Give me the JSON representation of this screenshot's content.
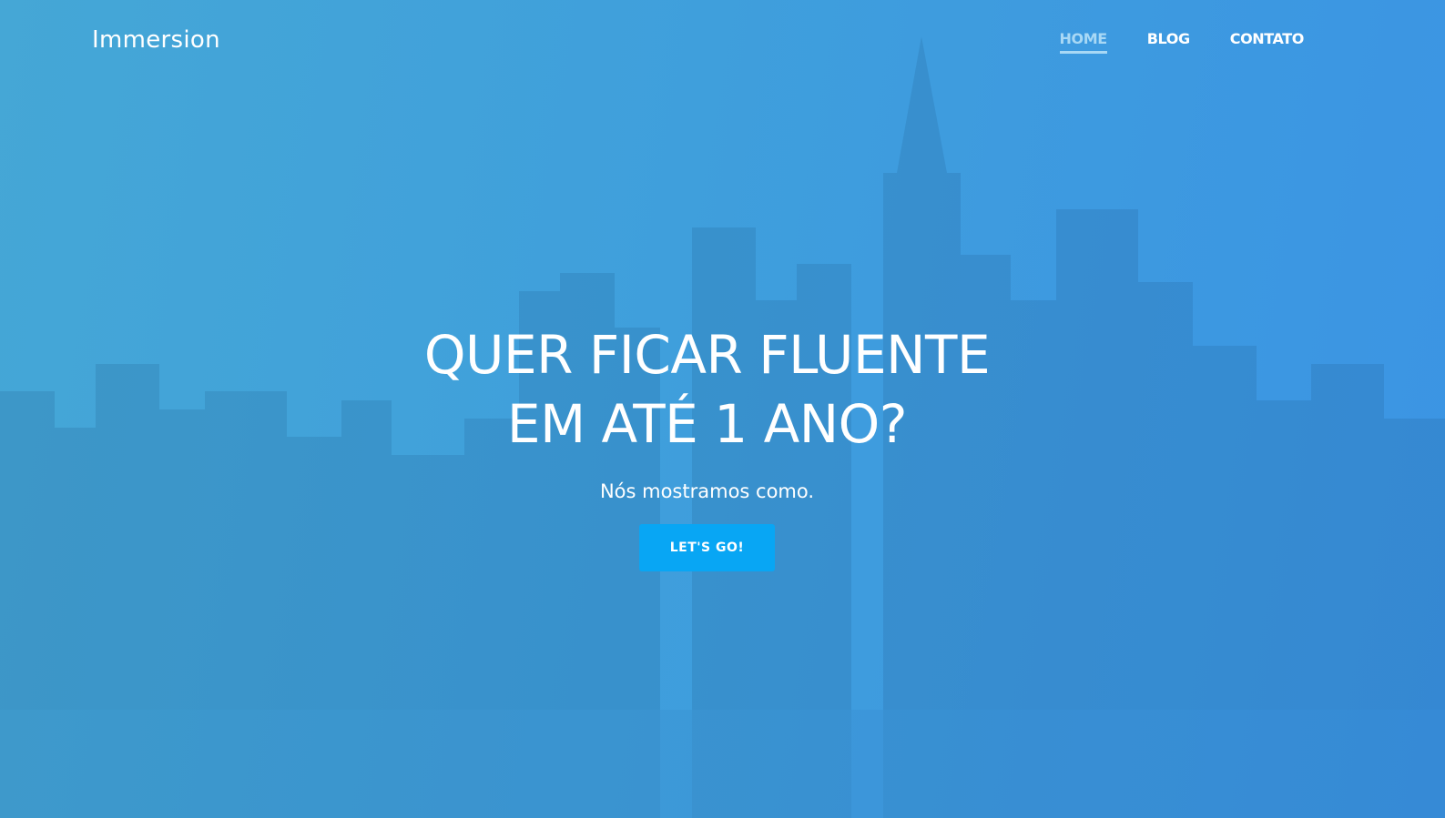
{
  "header": {
    "logo": "Immersion",
    "nav": [
      {
        "label": "HOME",
        "active": true
      },
      {
        "label": "BLOG",
        "active": false
      },
      {
        "label": "CONTATO",
        "active": false
      }
    ]
  },
  "hero": {
    "headline_line1": "QUER FICAR FLUENTE",
    "headline_line2": "EM ATÉ 1 ANO?",
    "subtitle": "Nós mostramos como.",
    "cta_label": "LET'S GO!"
  },
  "colors": {
    "background_start": "#45a7d6",
    "background_end": "#3b94e4",
    "cta": "#08a6f4",
    "nav_active": "#a8d8f5",
    "text": "#ffffff"
  }
}
